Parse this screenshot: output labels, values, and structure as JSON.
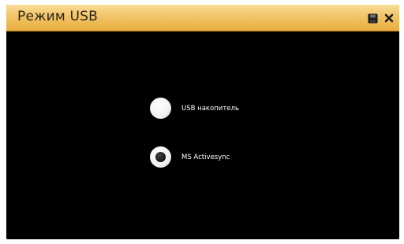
{
  "window": {
    "title": "Режим USB"
  },
  "title_bar_icons": [
    {
      "name": "save-icon"
    },
    {
      "name": "close-icon"
    }
  ],
  "options": [
    {
      "label": "USB накопитель",
      "selected": false
    },
    {
      "label": "MS Activesync",
      "selected": true
    }
  ],
  "colors": {
    "title_bar": "#f1c468",
    "background": "#000000",
    "text": "#ffffff"
  }
}
